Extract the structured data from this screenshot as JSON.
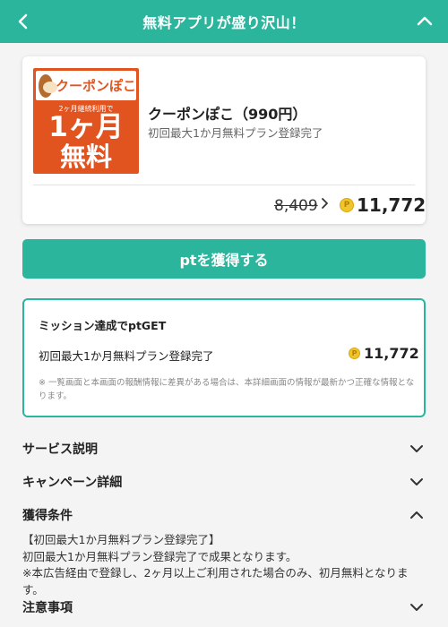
{
  "header": {
    "title": "無料アプリが盛り沢山！"
  },
  "offer": {
    "thumb": {
      "brand": "クーポンぽこ",
      "sub": "2ヶ月継続利用で",
      "big1": "1ヶ月",
      "big2": "無料"
    },
    "name": "クーポンぽこ（990円）",
    "description": "初回最大1か月無料プラン登録完了",
    "old_points": "8,409",
    "new_points": "11,772"
  },
  "get_button": {
    "label": "ptを獲得する"
  },
  "mission": {
    "title": "ミッション達成でptGET",
    "item_name": "初回最大1か月無料プラン登録完了",
    "item_points": "11,772",
    "note": "※ 一覧画面と本画面の報酬情報に差異がある場合は、本詳細画面の情報が最新かつ正確な情報となります。"
  },
  "sections": {
    "service": "サービス説明",
    "campaign": "キャンペーン詳細",
    "conditions": "獲得条件",
    "notes": "注意事項"
  },
  "conditions_body": {
    "line1": "【初回最大1か月無料プラン登録完了】",
    "line2": "初回最大1か月無料プラン登録完了で成果となります。",
    "line3": "※本広告経由で登録し、2ヶ月以上ご利用された場合のみ、初月無料となります。"
  },
  "colors": {
    "accent": "#2bb59c",
    "thumb_bg": "#e2541f",
    "coin": "#f0c52a"
  },
  "icons": {
    "back": "chevron-left-icon",
    "collapse": "chevron-up-icon",
    "arrow": "chevron-right-icon",
    "coin": "point-coin-icon",
    "expand": "chevron-down-icon"
  }
}
